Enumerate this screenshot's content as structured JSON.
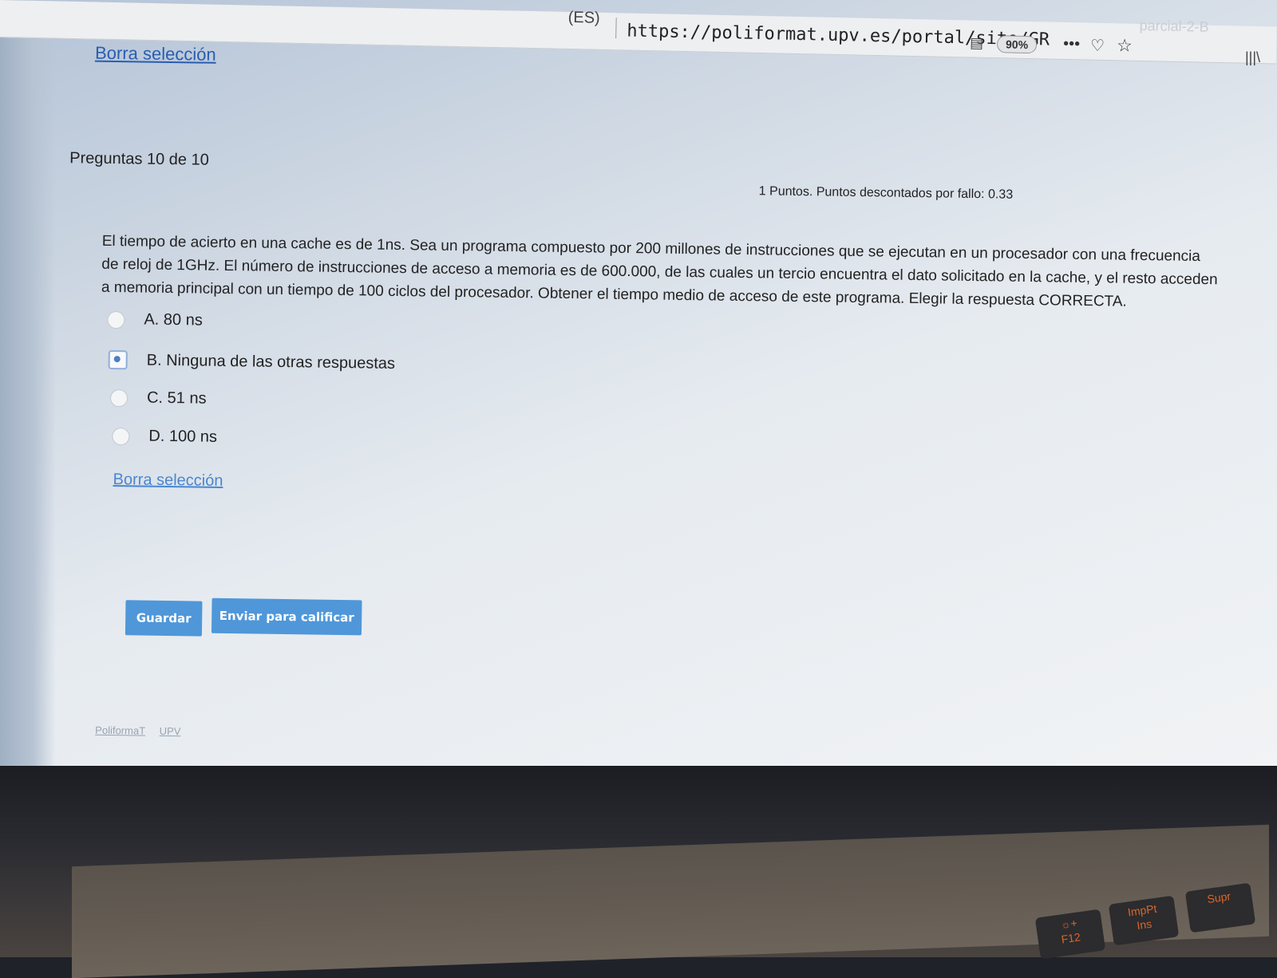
{
  "browser": {
    "tab_left": "(ES)",
    "url": "https://poliformat.upv.es/portal/site/GR",
    "zoom": "90%",
    "tab_right": "parcial-2-B"
  },
  "page": {
    "clear_selection_top": "Borra selección",
    "question_counter": "Preguntas 10 de 10",
    "points_info": "1 Puntos. Puntos descontados por fallo: 0.33",
    "question_text": "El tiempo de acierto en una cache es de 1ns. Sea un programa compuesto por 200 millones de instrucciones que se ejecutan en un procesador con una frecuencia de reloj de 1GHz. El número de instrucciones de acceso a memoria es de 600.000, de las cuales un tercio encuentra el dato solicitado en la cache, y el resto acceden a memoria principal con un tiempo de 100 ciclos del procesador. Obtener el tiempo medio de acceso de este programa. Elegir la respuesta CORRECTA.",
    "options": [
      {
        "label": "A. 80 ns",
        "selected": false
      },
      {
        "label": "B. Ninguna de las otras respuestas",
        "selected": true
      },
      {
        "label": "C. 51 ns",
        "selected": false
      },
      {
        "label": "D. 100 ns",
        "selected": false
      }
    ],
    "clear_selection_bottom": "Borra selección",
    "save_button": "Guardar",
    "submit_button": "Enviar para calificar",
    "footer_links": [
      "PoliformaT",
      "UPV"
    ]
  },
  "keyboard": {
    "keys": [
      {
        "label": "F12",
        "icon": "brightness-up-icon"
      },
      {
        "label": "ImpPt",
        "sub": "Ins"
      },
      {
        "label": "Supr"
      }
    ]
  },
  "colors": {
    "button": "#4f97d9",
    "link": "#2a5db0",
    "radio_selected": "#4b7fc2"
  }
}
